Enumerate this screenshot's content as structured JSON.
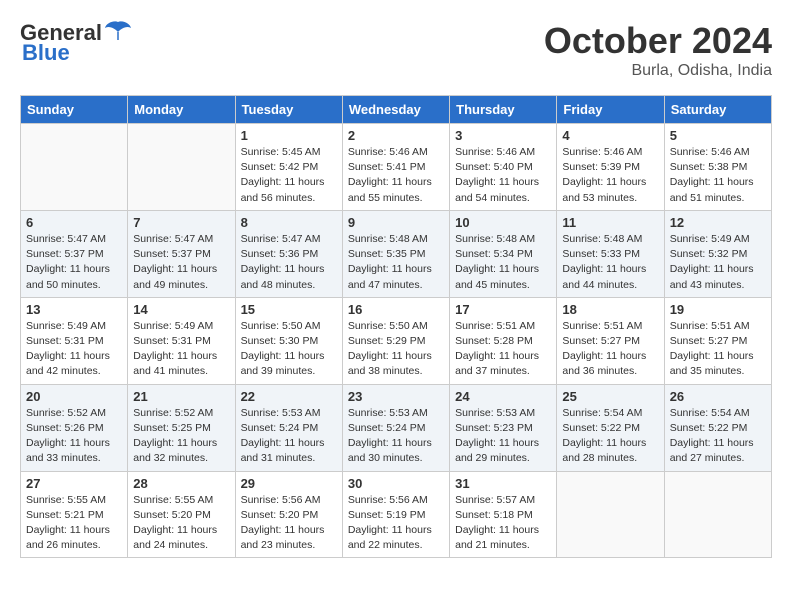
{
  "logo": {
    "general": "General",
    "blue": "Blue"
  },
  "title": {
    "month": "October 2024",
    "location": "Burla, Odisha, India"
  },
  "headers": [
    "Sunday",
    "Monday",
    "Tuesday",
    "Wednesday",
    "Thursday",
    "Friday",
    "Saturday"
  ],
  "weeks": [
    [
      {
        "day": "",
        "info": ""
      },
      {
        "day": "",
        "info": ""
      },
      {
        "day": "1",
        "info": "Sunrise: 5:45 AM\nSunset: 5:42 PM\nDaylight: 11 hours\nand 56 minutes."
      },
      {
        "day": "2",
        "info": "Sunrise: 5:46 AM\nSunset: 5:41 PM\nDaylight: 11 hours\nand 55 minutes."
      },
      {
        "day": "3",
        "info": "Sunrise: 5:46 AM\nSunset: 5:40 PM\nDaylight: 11 hours\nand 54 minutes."
      },
      {
        "day": "4",
        "info": "Sunrise: 5:46 AM\nSunset: 5:39 PM\nDaylight: 11 hours\nand 53 minutes."
      },
      {
        "day": "5",
        "info": "Sunrise: 5:46 AM\nSunset: 5:38 PM\nDaylight: 11 hours\nand 51 minutes."
      }
    ],
    [
      {
        "day": "6",
        "info": "Sunrise: 5:47 AM\nSunset: 5:37 PM\nDaylight: 11 hours\nand 50 minutes."
      },
      {
        "day": "7",
        "info": "Sunrise: 5:47 AM\nSunset: 5:37 PM\nDaylight: 11 hours\nand 49 minutes."
      },
      {
        "day": "8",
        "info": "Sunrise: 5:47 AM\nSunset: 5:36 PM\nDaylight: 11 hours\nand 48 minutes."
      },
      {
        "day": "9",
        "info": "Sunrise: 5:48 AM\nSunset: 5:35 PM\nDaylight: 11 hours\nand 47 minutes."
      },
      {
        "day": "10",
        "info": "Sunrise: 5:48 AM\nSunset: 5:34 PM\nDaylight: 11 hours\nand 45 minutes."
      },
      {
        "day": "11",
        "info": "Sunrise: 5:48 AM\nSunset: 5:33 PM\nDaylight: 11 hours\nand 44 minutes."
      },
      {
        "day": "12",
        "info": "Sunrise: 5:49 AM\nSunset: 5:32 PM\nDaylight: 11 hours\nand 43 minutes."
      }
    ],
    [
      {
        "day": "13",
        "info": "Sunrise: 5:49 AM\nSunset: 5:31 PM\nDaylight: 11 hours\nand 42 minutes."
      },
      {
        "day": "14",
        "info": "Sunrise: 5:49 AM\nSunset: 5:31 PM\nDaylight: 11 hours\nand 41 minutes."
      },
      {
        "day": "15",
        "info": "Sunrise: 5:50 AM\nSunset: 5:30 PM\nDaylight: 11 hours\nand 39 minutes."
      },
      {
        "day": "16",
        "info": "Sunrise: 5:50 AM\nSunset: 5:29 PM\nDaylight: 11 hours\nand 38 minutes."
      },
      {
        "day": "17",
        "info": "Sunrise: 5:51 AM\nSunset: 5:28 PM\nDaylight: 11 hours\nand 37 minutes."
      },
      {
        "day": "18",
        "info": "Sunrise: 5:51 AM\nSunset: 5:27 PM\nDaylight: 11 hours\nand 36 minutes."
      },
      {
        "day": "19",
        "info": "Sunrise: 5:51 AM\nSunset: 5:27 PM\nDaylight: 11 hours\nand 35 minutes."
      }
    ],
    [
      {
        "day": "20",
        "info": "Sunrise: 5:52 AM\nSunset: 5:26 PM\nDaylight: 11 hours\nand 33 minutes."
      },
      {
        "day": "21",
        "info": "Sunrise: 5:52 AM\nSunset: 5:25 PM\nDaylight: 11 hours\nand 32 minutes."
      },
      {
        "day": "22",
        "info": "Sunrise: 5:53 AM\nSunset: 5:24 PM\nDaylight: 11 hours\nand 31 minutes."
      },
      {
        "day": "23",
        "info": "Sunrise: 5:53 AM\nSunset: 5:24 PM\nDaylight: 11 hours\nand 30 minutes."
      },
      {
        "day": "24",
        "info": "Sunrise: 5:53 AM\nSunset: 5:23 PM\nDaylight: 11 hours\nand 29 minutes."
      },
      {
        "day": "25",
        "info": "Sunrise: 5:54 AM\nSunset: 5:22 PM\nDaylight: 11 hours\nand 28 minutes."
      },
      {
        "day": "26",
        "info": "Sunrise: 5:54 AM\nSunset: 5:22 PM\nDaylight: 11 hours\nand 27 minutes."
      }
    ],
    [
      {
        "day": "27",
        "info": "Sunrise: 5:55 AM\nSunset: 5:21 PM\nDaylight: 11 hours\nand 26 minutes."
      },
      {
        "day": "28",
        "info": "Sunrise: 5:55 AM\nSunset: 5:20 PM\nDaylight: 11 hours\nand 24 minutes."
      },
      {
        "day": "29",
        "info": "Sunrise: 5:56 AM\nSunset: 5:20 PM\nDaylight: 11 hours\nand 23 minutes."
      },
      {
        "day": "30",
        "info": "Sunrise: 5:56 AM\nSunset: 5:19 PM\nDaylight: 11 hours\nand 22 minutes."
      },
      {
        "day": "31",
        "info": "Sunrise: 5:57 AM\nSunset: 5:18 PM\nDaylight: 11 hours\nand 21 minutes."
      },
      {
        "day": "",
        "info": ""
      },
      {
        "day": "",
        "info": ""
      }
    ]
  ]
}
